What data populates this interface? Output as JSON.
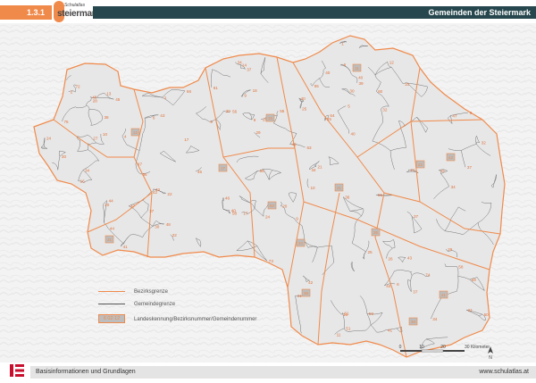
{
  "header": {
    "section": "1.3.1",
    "logo_top": "Schulatlas",
    "logo_name": "steiermark",
    "title": "Gemeinden der Steiermark"
  },
  "colors": {
    "accent": "#f08a4b",
    "title_bar": "#25474d",
    "relief": "#f3f3f3",
    "territory": "#e7e7e7",
    "municipal_line": "#555555",
    "district_line": "#f08a4b"
  },
  "map": {
    "district_codes": [
      "11",
      "12",
      "15",
      "17",
      "21",
      "22",
      "31",
      "34",
      "35",
      "36",
      "38",
      "41",
      "42",
      "62"
    ],
    "municipality_numbers": [
      "24",
      "34",
      "30",
      "58",
      "49",
      "21",
      "37",
      "32",
      "43",
      "21",
      "47",
      "10",
      "61",
      "22",
      "33",
      "56",
      "4",
      "36",
      "73",
      "14",
      "44",
      "30",
      "47",
      "41",
      "45",
      "25",
      "30",
      "51",
      "21",
      "66",
      "48",
      "9",
      "20",
      "41",
      "6",
      "18",
      "25",
      "40",
      "50",
      "24",
      "55",
      "75",
      "72",
      "34",
      "9",
      "56",
      "12",
      "17",
      "8",
      "31",
      "16",
      "35",
      "1",
      "43",
      "29",
      "42",
      "40",
      "17",
      "31",
      "74",
      "61",
      "13",
      "2",
      "46",
      "42",
      "59",
      "58",
      "51",
      "37",
      "80",
      "27",
      "48",
      "16",
      "45",
      "43",
      "63",
      "10",
      "39",
      "40",
      "37",
      "9",
      "29",
      "22",
      "37",
      "9",
      "25",
      "55",
      "40",
      "11",
      "40",
      "34",
      "36",
      "34",
      "6",
      "44",
      "5",
      "30",
      "26",
      "32",
      "34",
      "44",
      "37",
      "38",
      "64",
      "6",
      "59",
      "47",
      "1",
      "20",
      "28"
    ]
  },
  "legend": {
    "district_border": "Bezirksgrenze",
    "municipal_border": "Gemeindegrenze",
    "code_sample": "6 02 12",
    "code_label": "Landeskennung/Bezirksnummer/Gemeindenummer"
  },
  "scale": {
    "ticks": [
      "0",
      "10",
      "20",
      "30 Kilometer"
    ],
    "north": "N"
  },
  "footer": {
    "left": "Basisinformationen und Grundlagen",
    "right": "www.schulatlas.at"
  }
}
